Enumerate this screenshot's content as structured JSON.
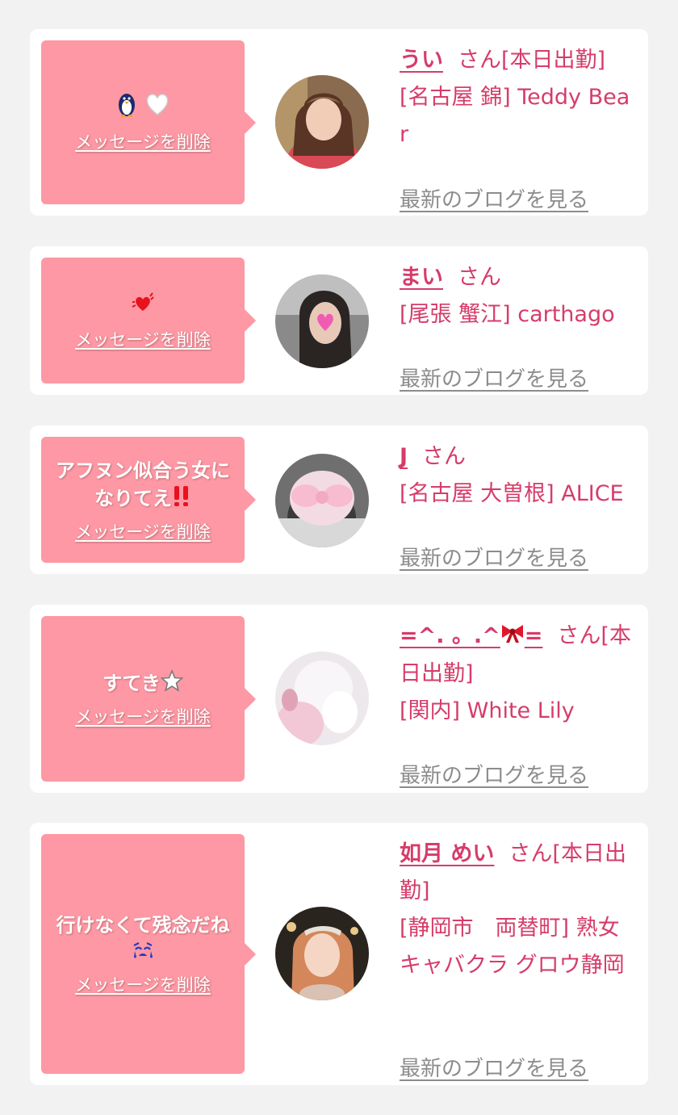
{
  "colors": {
    "bubble": "#fd98a4",
    "accent": "#d63c6a",
    "link_gray": "#8c8c8c",
    "background": "#f2f2f2"
  },
  "labels": {
    "delete": "メッセージを削除",
    "blog": "最新のブログを見る",
    "san": "さん"
  },
  "messages": [
    {
      "message": "",
      "message_icons": [
        "penguin-icon",
        "white-heart-icon"
      ],
      "name": "うい",
      "status": "[本日出勤]",
      "shop": "[名古屋 錦] Teddy Bear",
      "delete": "メッセージを削除",
      "blog": "最新のブログを見る"
    },
    {
      "message": "",
      "message_icons": [
        "beating-heart-icon"
      ],
      "name": "まい",
      "status": "",
      "shop": "[尾張 蟹江] carthago",
      "delete": "メッセージを削除",
      "blog": "最新のブログを見る"
    },
    {
      "message": "アフヌン似合う女になりてえ",
      "message_icons": [
        "double-exclamation-icon"
      ],
      "name": "J",
      "status": "",
      "shop": "[名古屋 大曽根] ALICE",
      "delete": "メッセージを削除",
      "blog": "最新のブログを見る"
    },
    {
      "message": "すてき",
      "message_icons": [
        "star-icon"
      ],
      "name": "=^. 。.^",
      "name_suffix": "=",
      "name_icons": [
        "ribbon-icon"
      ],
      "status": "[本日出勤]",
      "shop": "[関内] White Lily",
      "delete": "メッセージを削除",
      "blog": "最新のブログを見る"
    },
    {
      "message": "行けなくて残念だね",
      "message_icons": [
        "crying-face-icon"
      ],
      "name": "如月 めい",
      "status": "[本日出勤]",
      "shop": "[静岡市　両替町] 熟女キャバクラ グロウ静岡",
      "delete": "メッセージを削除",
      "blog": "最新のブログを見る"
    }
  ]
}
